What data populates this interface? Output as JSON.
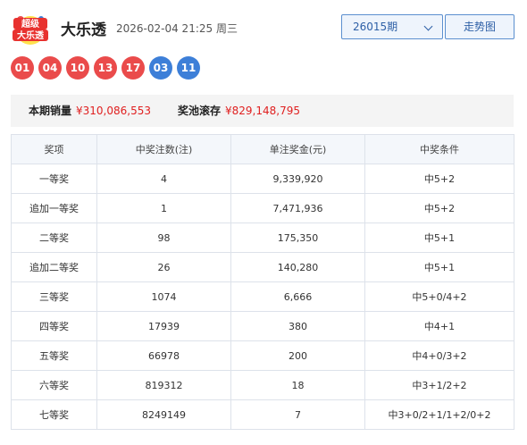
{
  "header": {
    "logo_text_top": "超级",
    "logo_text_bottom": "大乐透",
    "title": "大乐透",
    "draw_time": "2026-02-04 21:25 周三",
    "period_selected": "26015期",
    "trend_button": "走势图"
  },
  "balls": {
    "front": [
      "01",
      "04",
      "10",
      "13",
      "17"
    ],
    "back": [
      "03",
      "11"
    ]
  },
  "colors": {
    "front_ball": "#ea4b4b",
    "back_ball": "#3d7fd8",
    "accent_text": "#e02020"
  },
  "summary": {
    "sales_label": "本期销量",
    "sales_value": "¥310,086,553",
    "pool_label": "奖池滚存",
    "pool_value": "¥829,148,795"
  },
  "table": {
    "headers": [
      "奖项",
      "中奖注数(注)",
      "单注奖金(元)",
      "中奖条件"
    ],
    "rows": [
      {
        "level": "一等奖",
        "count": "4",
        "amount": "9,339,920",
        "condition": "中5+2"
      },
      {
        "level": "追加一等奖",
        "count": "1",
        "amount": "7,471,936",
        "condition": "中5+2"
      },
      {
        "level": "二等奖",
        "count": "98",
        "amount": "175,350",
        "condition": "中5+1"
      },
      {
        "level": "追加二等奖",
        "count": "26",
        "amount": "140,280",
        "condition": "中5+1"
      },
      {
        "level": "三等奖",
        "count": "1074",
        "amount": "6,666",
        "condition": "中5+0/4+2"
      },
      {
        "level": "四等奖",
        "count": "17939",
        "amount": "380",
        "condition": "中4+1"
      },
      {
        "level": "五等奖",
        "count": "66978",
        "amount": "200",
        "condition": "中4+0/3+2"
      },
      {
        "level": "六等奖",
        "count": "819312",
        "amount": "18",
        "condition": "中3+1/2+2"
      },
      {
        "level": "七等奖",
        "count": "8249149",
        "amount": "7",
        "condition": "中3+0/2+1/1+2/0+2"
      }
    ]
  }
}
